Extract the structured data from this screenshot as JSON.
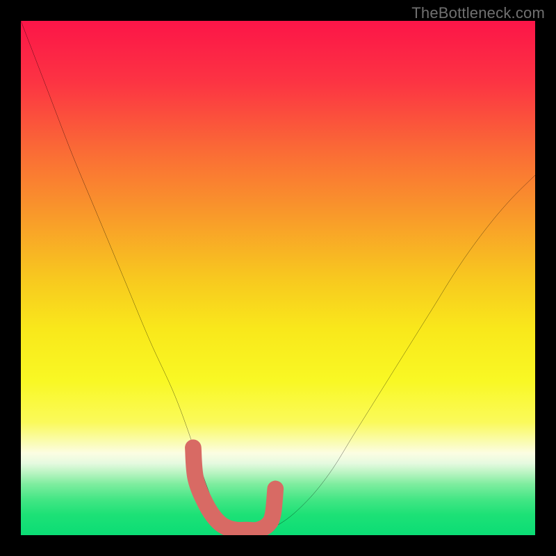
{
  "watermark": "TheBottleneck.com",
  "chart_data": {
    "type": "line",
    "title": "",
    "xlabel": "",
    "ylabel": "",
    "xlim": [
      0,
      100
    ],
    "ylim": [
      0,
      100
    ],
    "series": [
      {
        "name": "curve",
        "x": [
          0,
          5,
          10,
          15,
          20,
          25,
          30,
          34,
          36,
          38,
          40,
          42,
          46,
          50,
          55,
          60,
          65,
          70,
          75,
          80,
          85,
          90,
          95,
          100
        ],
        "y": [
          100,
          87,
          74,
          62,
          50,
          38,
          27,
          16,
          10,
          5,
          2,
          1,
          1,
          2,
          6,
          12,
          20,
          28,
          36,
          44,
          52,
          59,
          65,
          70
        ]
      },
      {
        "name": "highlight",
        "x": [
          33.5,
          34,
          36,
          38,
          40,
          42,
          44,
          46,
          48,
          49,
          49.5
        ],
        "y": [
          17,
          11,
          6,
          3,
          1.5,
          1,
          1,
          1,
          2,
          4,
          9
        ]
      }
    ],
    "gradient_stops": [
      {
        "offset": 0,
        "color": "#fc1548"
      },
      {
        "offset": 12,
        "color": "#fc3443"
      },
      {
        "offset": 25,
        "color": "#fa6a36"
      },
      {
        "offset": 38,
        "color": "#f99a2a"
      },
      {
        "offset": 50,
        "color": "#f8c81f"
      },
      {
        "offset": 60,
        "color": "#f9e81b"
      },
      {
        "offset": 70,
        "color": "#f9f824"
      },
      {
        "offset": 78,
        "color": "#fafa5a"
      },
      {
        "offset": 82,
        "color": "#fafcb4"
      },
      {
        "offset": 84,
        "color": "#fcfde2"
      },
      {
        "offset": 86,
        "color": "#e6fae0"
      },
      {
        "offset": 88,
        "color": "#b6f4c0"
      },
      {
        "offset": 90,
        "color": "#80eda0"
      },
      {
        "offset": 93,
        "color": "#44e685"
      },
      {
        "offset": 96,
        "color": "#1de176"
      },
      {
        "offset": 100,
        "color": "#0bdd75"
      }
    ]
  }
}
